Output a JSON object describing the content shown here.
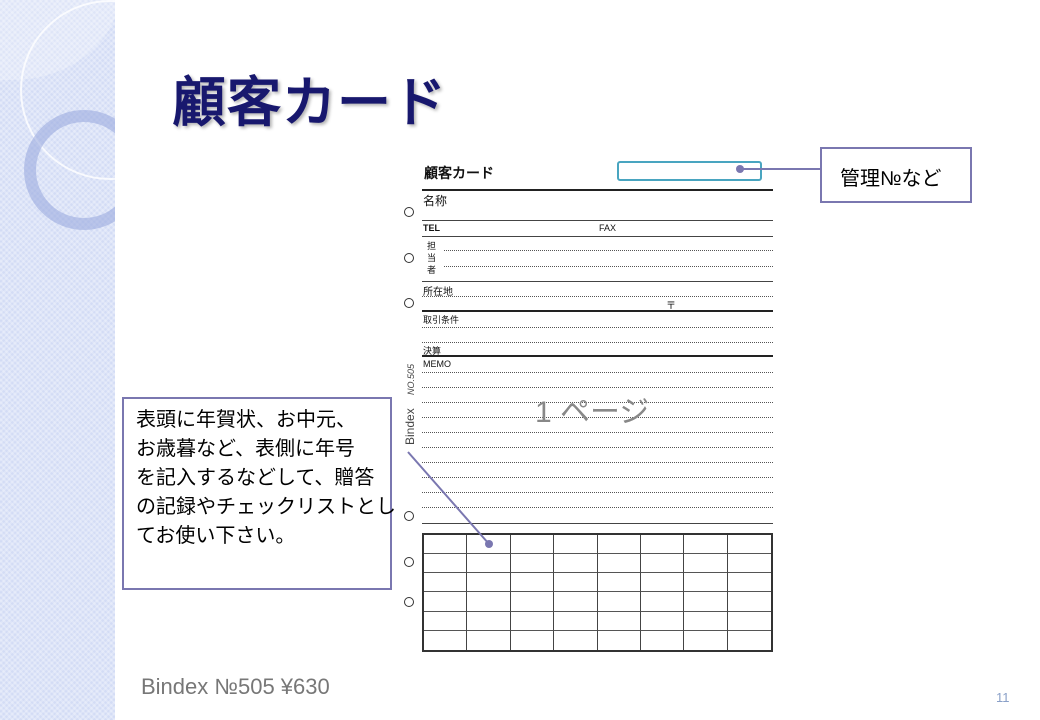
{
  "slide": {
    "title": "顧客カード",
    "footer": "Bindex №505 ¥630",
    "page_number": "11",
    "accent_color": "#7a77b0",
    "title_color": "#18186e"
  },
  "form": {
    "title": "顧客カード",
    "name_label": "名称",
    "tel_label": "TEL",
    "fax_label": "FAX",
    "contact_label": [
      "担",
      "当",
      "者"
    ],
    "address_label": "所在地",
    "postal_mark": "〒",
    "terms_label": "取引条件",
    "settlement_label": "決算",
    "memo_label": "MEMO",
    "side_brand": "Bindex",
    "side_number": "NO.505",
    "watermark": "1 ページ",
    "grid": {
      "columns": 8,
      "rows": 6
    }
  },
  "callouts": {
    "management": "管理№など",
    "usage": [
      "表頭に年賀状、お中元、",
      "お歳暮など、表側に年号",
      "を記入するなどして、贈答",
      "の記録やチェックリストとし",
      "てお使い下さい。"
    ]
  }
}
